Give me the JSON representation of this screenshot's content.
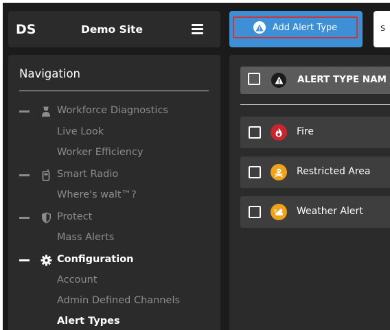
{
  "header": {
    "brand_short": "DS",
    "site_name": "Demo Site",
    "menu_icon": "hamburger-icon",
    "add_button_label": "Add Alert Type",
    "add_button_icon": "warning-icon",
    "search_partial": "S"
  },
  "sidebar": {
    "title": "Navigation",
    "sections": [
      {
        "label": "Workforce Diagnostics",
        "icon": "worker-icon",
        "children": [
          "Live Look",
          "Worker Efficiency"
        ]
      },
      {
        "label": "Smart Radio",
        "icon": "radio-icon",
        "children": [
          "Where's walt™?"
        ]
      },
      {
        "label": "Protect",
        "icon": "shield-icon",
        "children": [
          "Mass Alerts"
        ]
      },
      {
        "label": "Configuration",
        "icon": "gear-icon",
        "active": true,
        "children": [
          "Account",
          "Admin Defined Channels",
          "Alert Types"
        ]
      }
    ],
    "active_child": "Alert Types"
  },
  "main": {
    "column_header": "ALERT TYPE NAM",
    "column_icon": "warning-icon",
    "rows": [
      {
        "label": "Fire",
        "icon": "fire-icon",
        "color": "#c8262e"
      },
      {
        "label": "Restricted Area",
        "icon": "skull-icon",
        "color": "#f0a21b"
      },
      {
        "label": "Weather Alert",
        "icon": "weather-icon",
        "color": "#f0a21b"
      }
    ]
  },
  "colors": {
    "accent": "#3d8fd6",
    "highlight_border": "#d0343a",
    "panel": "#2b2b2b",
    "background": "#1b1b1b"
  }
}
